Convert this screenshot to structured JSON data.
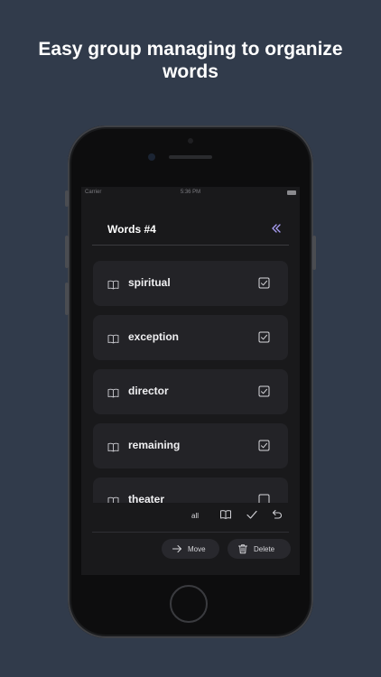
{
  "headline": {
    "line1": "Easy group managing to organize",
    "line2": "words"
  },
  "status_bar": {
    "carrier": "Carrier",
    "time": "5:36 PM"
  },
  "screen": {
    "title": "Words #4",
    "collapse_icon": "double-chevron-left-icon",
    "words": [
      {
        "label": "spiritual",
        "icon": "book-icon",
        "checked": true
      },
      {
        "label": "exception",
        "icon": "book-icon",
        "checked": true
      },
      {
        "label": "director",
        "icon": "book-icon",
        "checked": true
      },
      {
        "label": "remaining",
        "icon": "book-icon",
        "checked": true
      },
      {
        "label": "theater",
        "icon": "book-icon",
        "checked": false
      }
    ],
    "toolbar": {
      "all_label": "all",
      "icons": [
        "book-icon",
        "check-icon",
        "undo-icon"
      ],
      "move_label": "Move",
      "delete_label": "Delete"
    }
  },
  "colors": {
    "background": "#313b4b",
    "screen": "#19191b",
    "card": "#232327",
    "accent": "#a99ef5"
  }
}
